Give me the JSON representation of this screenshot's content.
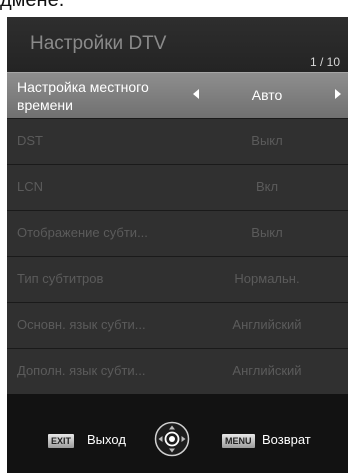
{
  "top_text": "дмене.",
  "menu": {
    "title": "Настройки DTV",
    "page": "1 / 10",
    "items": [
      {
        "label": "Настройка местного времени",
        "value": "Авто"
      },
      {
        "label": "DST",
        "value": "Выкл"
      },
      {
        "label": "LCN",
        "value": "Вкл"
      },
      {
        "label": "Отображение субти...",
        "value": "Выкл"
      },
      {
        "label": "Тип субтитров",
        "value": "Нормальн."
      },
      {
        "label": "Основн. язык субти...",
        "value": "Английский"
      },
      {
        "label": "Дополн. язык субти...",
        "value": "Английский"
      }
    ],
    "selected_index": 0
  },
  "footer": {
    "exit_key": "EXIT",
    "exit_label": "Выход",
    "menu_key": "MENU",
    "menu_label": "Возврат",
    "nav_icon": "dpad-icon"
  },
  "colors": {
    "selected_row": "#808080",
    "row": "#303030",
    "background": "#121212"
  }
}
